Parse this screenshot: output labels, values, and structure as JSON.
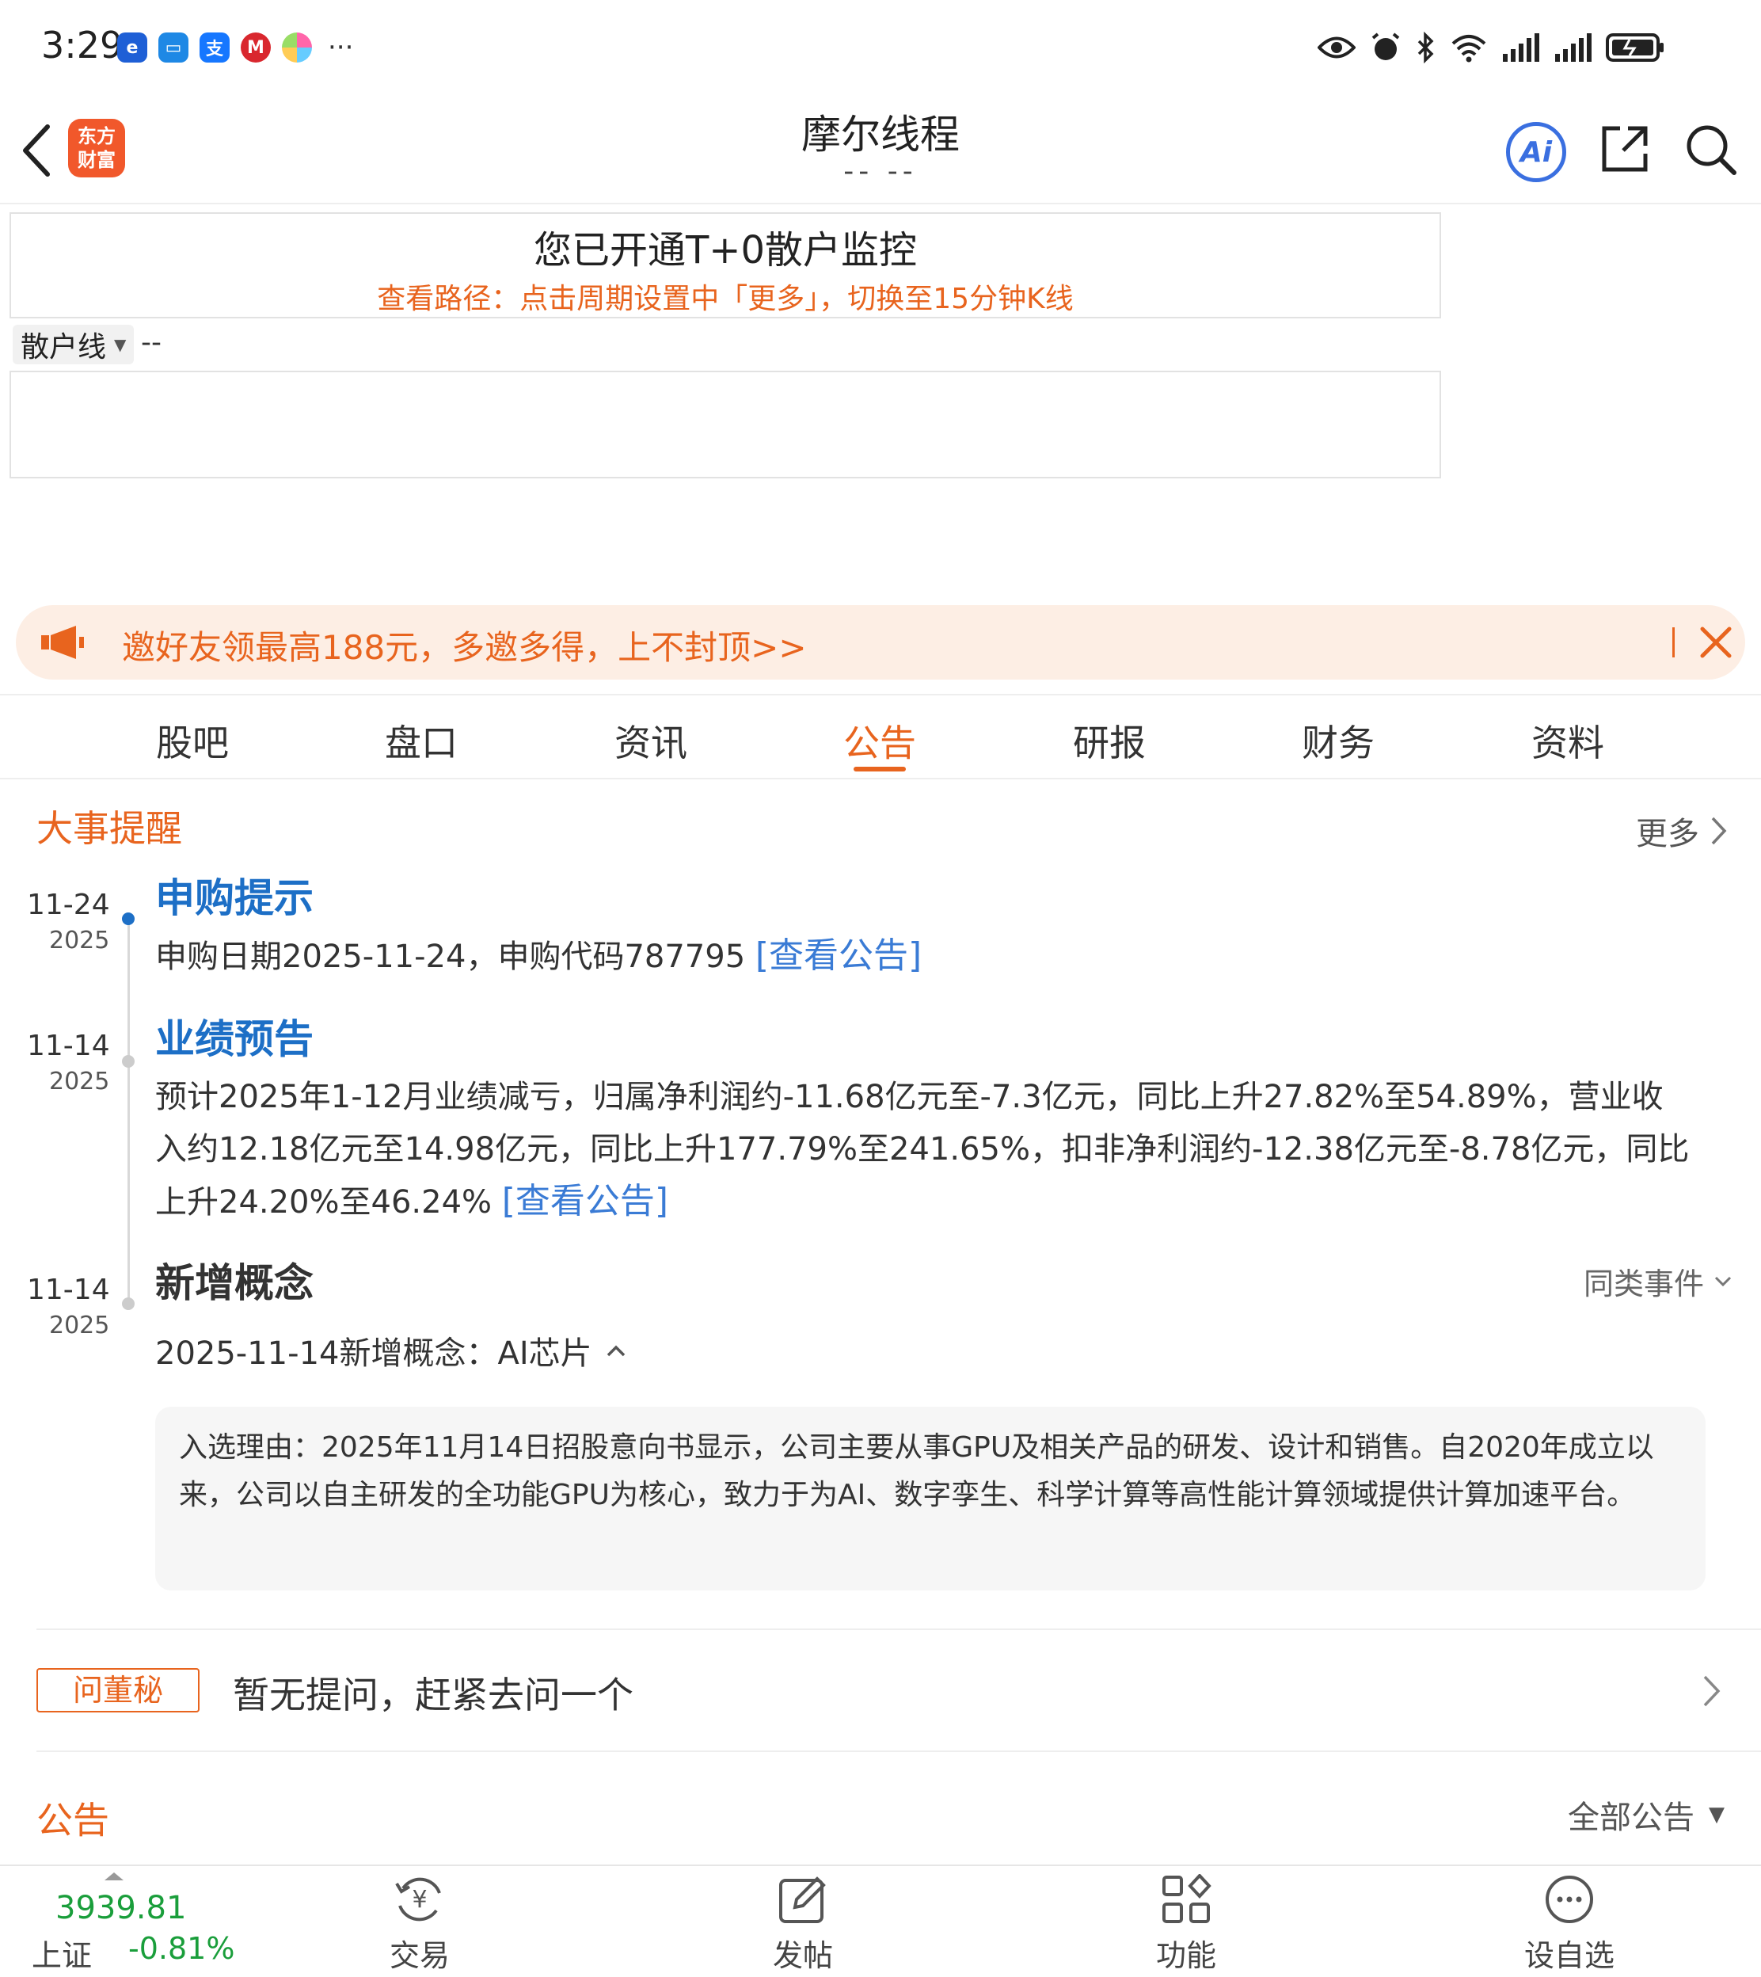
{
  "status_bar": {
    "time": "3:29",
    "more": "···"
  },
  "header": {
    "title": "摩尔线程",
    "subtitle": "--  --",
    "logo_line1": "东方",
    "logo_line2": "财富",
    "ai_label": "Ai"
  },
  "t0_panel": {
    "title": "您已开通T+0散户监控",
    "path": "查看路径：点击周期设置中「更多」，切换至15分钟K线",
    "select_label": "散户线",
    "select_value": "--"
  },
  "banner": {
    "text": "邀好友领最高188元，多邀多得，上不封顶>>"
  },
  "tabs": [
    {
      "label": "股吧"
    },
    {
      "label": "盘口"
    },
    {
      "label": "资讯"
    },
    {
      "label": "公告",
      "active": true
    },
    {
      "label": "研报"
    },
    {
      "label": "财务"
    },
    {
      "label": "资料"
    }
  ],
  "events": {
    "section_title": "大事提醒",
    "more_label": "更多",
    "items": [
      {
        "date": "11-24",
        "year": "2025",
        "title": "申购提示",
        "desc": "申购日期2025-11-24，申购代码787795 ",
        "link": "[查看公告]"
      },
      {
        "date": "11-14",
        "year": "2025",
        "title": "业绩预告",
        "desc": "预计2025年1-12月业绩减亏，归属净利润约-11.68亿元至-7.3亿元，同比上升27.82%至54.89%，营业收入约12.18亿元至14.98亿元，同比上升177.79%至241.65%，扣非净利润约-12.38亿元至-8.78亿元，同比上升24.20%至46.24% ",
        "link": "[查看公告]"
      },
      {
        "date": "11-14",
        "year": "2025",
        "title": "新增概念",
        "similar_label": "同类事件",
        "concept": "2025-11-14新增概念：AI芯片",
        "reason": "入选理由：2025年11月14日招股意向书显示，公司主要从事GPU及相关产品的研发、设计和销售。自2020年成立以来，公司以自主研发的全功能GPU为核心，致力于为AI、数字孪生、科学计算等高性能计算领域提供计算加速平台。"
      }
    ]
  },
  "ask": {
    "badge": "问董秘",
    "text": "暂无提问，赶紧去问一个"
  },
  "announcements": {
    "title": "公告",
    "filter": "全部公告"
  },
  "bottom_bar": {
    "index_value": "3939.81",
    "index_name": "上证",
    "index_change": "-0.81%",
    "items": [
      {
        "label": "交易",
        "icon": "yuan-exchange-icon"
      },
      {
        "label": "发帖",
        "icon": "edit-icon"
      },
      {
        "label": "功能",
        "icon": "apps-grid-icon"
      },
      {
        "label": "设自选",
        "icon": "more-circle-icon"
      }
    ]
  },
  "colors": {
    "accent": "#e8641e",
    "link": "#1d6fc6",
    "down": "#1a9e3b"
  }
}
